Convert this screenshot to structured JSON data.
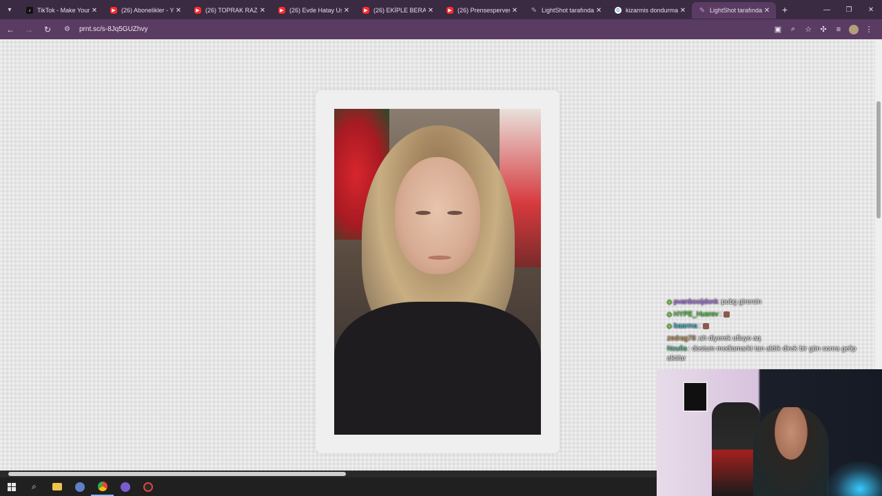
{
  "browser": {
    "tabs": [
      {
        "title": "TikTok - Make Your D",
        "favicon": "tiktok"
      },
      {
        "title": "(26) Abonelikler - You",
        "favicon": "yt"
      },
      {
        "title": "(26) TOPRAK RAZGAT",
        "favicon": "yt"
      },
      {
        "title": "(26) Evde Hatay Usülü",
        "favicon": "yt"
      },
      {
        "title": "(26) EKİPLE BERABER",
        "favicon": "yt"
      },
      {
        "title": "(26) Prensesperver ve",
        "favicon": "yt"
      },
      {
        "title": "LightShot tarafından",
        "favicon": "ls"
      },
      {
        "title": "kizarmis dondurma -",
        "favicon": "g"
      },
      {
        "title": "LightShot tarafından",
        "favicon": "ls",
        "active": true
      }
    ],
    "url": "prnt.sc/s-8Jq5GUZhvy",
    "icons": {
      "tab_search": "chevron-down-icon",
      "back": "back-arrow-icon",
      "forward": "forward-arrow-icon",
      "reload": "reload-icon",
      "site_info": "site-info-icon",
      "cast": "cast-icon",
      "zoom": "zoom-icon",
      "bookmark": "star-icon",
      "extensions": "puzzle-icon",
      "media": "media-control-icon",
      "menu": "kebab-menu-icon"
    },
    "colors": {
      "tab_strip": "#3a2a42",
      "toolbar": "#5a3c63"
    }
  },
  "chat": [
    {
      "user": "pvanbooijdonk",
      "user_color": "#b57cff",
      "message": "pubg girersin",
      "badge": true
    },
    {
      "user": "HYPE_Husrev",
      "user_color": "#4fe03a",
      "message": "",
      "badge": true,
      "emote": true
    },
    {
      "user": "baarma",
      "user_color": "#35c6e8",
      "message": "",
      "badge": true,
      "emote": true
    },
    {
      "user": "zedrag78",
      "user_color": "#d7a96a",
      "message": "ah diyerek ufluyo aq",
      "badge": false
    },
    {
      "user": "Noufia",
      "user_color": "#5fd0a0",
      "message": "dostum mediamarkt tan aldık direk bir gün sonra gelip aktılar",
      "badge": false
    }
  ],
  "taskbar": {
    "icons": [
      "windows-start-icon",
      "search-icon",
      "file-explorer-icon",
      "app-icon",
      "chrome-icon",
      "discord-icon",
      "recorder-icon"
    ]
  }
}
